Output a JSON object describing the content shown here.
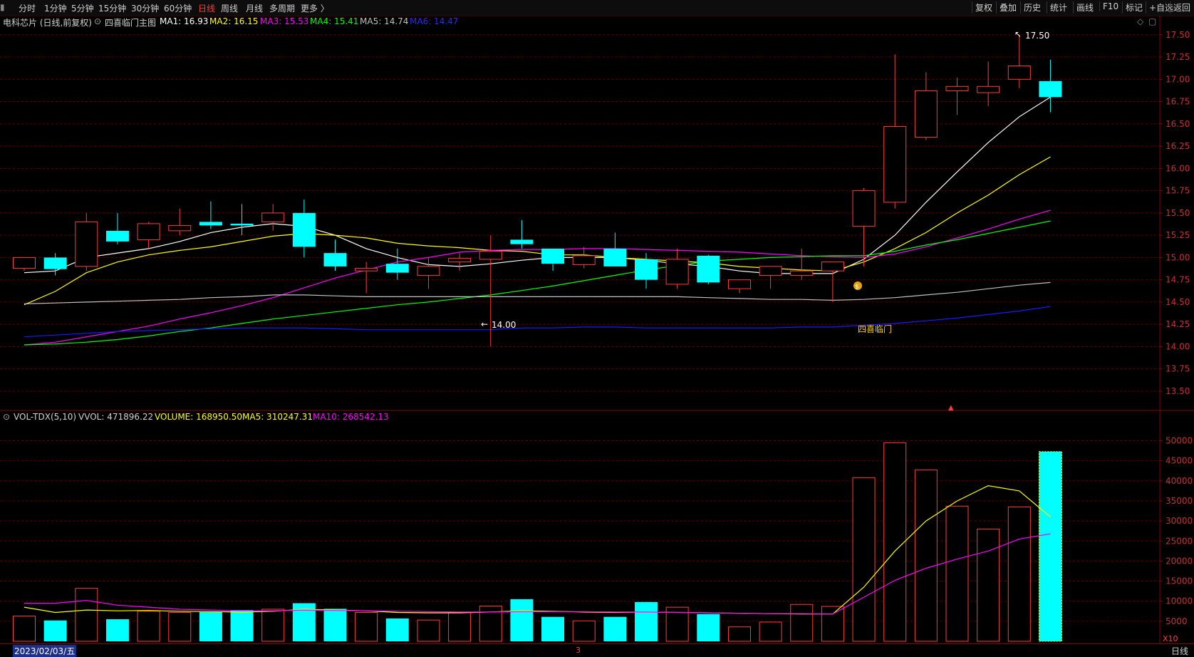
{
  "toolbar": {
    "left": [
      "分时",
      "1分钟",
      "5分钟",
      "15分钟",
      "30分钟",
      "60分钟",
      "日线",
      "周线",
      "月线",
      "多周期",
      "更多 〉"
    ],
    "active": "日线",
    "right": [
      "复权",
      "叠加",
      "历史",
      "统计",
      "画线",
      "F10",
      "标记",
      "+自选",
      "返回"
    ]
  },
  "main_info": {
    "stock": "电科芯片 (日线,前复权)",
    "indicator": "四喜临门主图",
    "ma1": "MA1: 16.93",
    "ma2": "MA2: 16.15",
    "ma3": "MA3: 15.53",
    "ma4": "MA4: 15.41",
    "ma5": "MA5: 14.74",
    "ma6": "MA6: 14.47"
  },
  "vol_info": {
    "title": "VOL-TDX(5,10)",
    "vvol": "VVOL: 471896.22",
    "volume": "VOLUME: 168950.50",
    "ma5": "MA5: 310247.31",
    "ma10": "MA10: 268542.13"
  },
  "annotations": {
    "high": "17.50",
    "low": "14.00",
    "signal": "四喜临门"
  },
  "bottom": {
    "date": "2023/02/03/五",
    "period": "日线",
    "marker": "3",
    "scale": "X10"
  },
  "colors": {
    "up": "#ff3b3b",
    "down": "#00ffff",
    "ma1": "#ffffff",
    "ma2": "#ffff00",
    "ma3": "#ff00ff",
    "ma4": "#00ff00",
    "ma5": "#c0c0c0",
    "ma6": "#1a1aff"
  },
  "chart_data": [
    {
      "type": "candlestick",
      "title": "电科芯片 (日线,前复权)",
      "ylim": [
        13.3,
        17.65
      ],
      "yticks": [
        "17.50",
        "17.25",
        "17.00",
        "16.75",
        "16.50",
        "16.25",
        "16.00",
        "15.75",
        "15.50",
        "15.25",
        "15.00",
        "14.75",
        "14.50",
        "14.25",
        "14.00",
        "13.75",
        "13.50"
      ],
      "candles": [
        {
          "o": 14.88,
          "h": 15.0,
          "l": 14.85,
          "c": 15.0
        },
        {
          "o": 15.0,
          "h": 15.05,
          "l": 14.8,
          "c": 14.87
        },
        {
          "o": 14.9,
          "h": 15.5,
          "l": 14.85,
          "c": 15.4
        },
        {
          "o": 15.3,
          "h": 15.5,
          "l": 15.15,
          "c": 15.18
        },
        {
          "o": 15.2,
          "h": 15.4,
          "l": 15.1,
          "c": 15.38
        },
        {
          "o": 15.3,
          "h": 15.55,
          "l": 15.25,
          "c": 15.36
        },
        {
          "o": 15.4,
          "h": 15.63,
          "l": 15.32,
          "c": 15.36
        },
        {
          "o": 15.38,
          "h": 15.6,
          "l": 15.25,
          "c": 15.36
        },
        {
          "o": 15.4,
          "h": 15.6,
          "l": 15.3,
          "c": 15.5
        },
        {
          "o": 15.5,
          "h": 15.65,
          "l": 15.0,
          "c": 15.12
        },
        {
          "o": 15.05,
          "h": 15.2,
          "l": 14.85,
          "c": 14.9
        },
        {
          "o": 14.85,
          "h": 14.95,
          "l": 14.6,
          "c": 14.88
        },
        {
          "o": 14.93,
          "h": 15.1,
          "l": 14.75,
          "c": 14.83
        },
        {
          "o": 14.8,
          "h": 15.0,
          "l": 14.65,
          "c": 14.9
        },
        {
          "o": 14.95,
          "h": 15.05,
          "l": 14.85,
          "c": 14.99
        },
        {
          "o": 14.98,
          "h": 15.25,
          "l": 14.0,
          "c": 15.07
        },
        {
          "o": 15.2,
          "h": 15.42,
          "l": 15.1,
          "c": 15.15
        },
        {
          "o": 15.1,
          "h": 15.1,
          "l": 14.85,
          "c": 14.93
        },
        {
          "o": 14.92,
          "h": 15.12,
          "l": 14.88,
          "c": 15.02
        },
        {
          "o": 15.1,
          "h": 15.28,
          "l": 14.9,
          "c": 14.9
        },
        {
          "o": 14.98,
          "h": 15.05,
          "l": 14.65,
          "c": 14.75
        },
        {
          "o": 14.7,
          "h": 15.1,
          "l": 14.65,
          "c": 14.98
        },
        {
          "o": 15.02,
          "h": 15.03,
          "l": 14.7,
          "c": 14.72
        },
        {
          "o": 14.65,
          "h": 14.75,
          "l": 14.6,
          "c": 14.75
        },
        {
          "o": 14.8,
          "h": 14.9,
          "l": 14.65,
          "c": 14.9
        },
        {
          "o": 14.8,
          "h": 15.1,
          "l": 14.75,
          "c": 14.85
        },
        {
          "o": 14.85,
          "h": 14.95,
          "l": 14.5,
          "c": 14.95
        },
        {
          "o": 15.35,
          "h": 15.78,
          "l": 14.9,
          "c": 15.75
        },
        {
          "o": 15.62,
          "h": 17.28,
          "l": 15.55,
          "c": 16.47
        },
        {
          "o": 16.35,
          "h": 17.08,
          "l": 16.32,
          "c": 16.87
        },
        {
          "o": 16.87,
          "h": 17.02,
          "l": 16.6,
          "c": 16.92
        },
        {
          "o": 16.85,
          "h": 17.2,
          "l": 16.7,
          "c": 16.92
        },
        {
          "o": 17.0,
          "h": 17.5,
          "l": 16.9,
          "c": 17.15
        },
        {
          "o": 16.98,
          "h": 17.22,
          "l": 16.63,
          "c": 16.8
        }
      ],
      "series": [
        {
          "name": "MA1",
          "values": [
            14.83,
            14.85,
            15.0,
            15.05,
            15.1,
            15.18,
            15.28,
            15.34,
            15.38,
            15.35,
            15.25,
            15.1,
            15.0,
            14.92,
            14.9,
            14.93,
            14.97,
            15.0,
            15.0,
            15.0,
            14.97,
            14.93,
            14.9,
            14.85,
            14.82,
            14.82,
            14.82,
            14.98,
            15.25,
            15.62,
            15.96,
            16.29,
            16.58,
            16.8
          ]
        },
        {
          "name": "MA2",
          "values": [
            14.47,
            14.62,
            14.83,
            14.95,
            15.03,
            15.08,
            15.12,
            15.18,
            15.24,
            15.27,
            15.25,
            15.22,
            15.16,
            15.13,
            15.11,
            15.08,
            15.07,
            15.03,
            15.03,
            15.0,
            14.98,
            14.96,
            14.94,
            14.9,
            14.88,
            14.86,
            14.85,
            14.95,
            15.1,
            15.28,
            15.5,
            15.7,
            15.93,
            16.13
          ]
        },
        {
          "name": "MA3",
          "values": [
            14.02,
            14.05,
            14.11,
            14.17,
            14.23,
            14.31,
            14.38,
            14.46,
            14.55,
            14.66,
            14.77,
            14.86,
            14.95,
            15.0,
            15.06,
            15.08,
            15.09,
            15.09,
            15.1,
            15.1,
            15.09,
            15.08,
            15.07,
            15.06,
            15.04,
            15.02,
            15.01,
            15.0,
            15.04,
            15.12,
            15.22,
            15.32,
            15.43,
            15.53
          ]
        },
        {
          "name": "MA4",
          "values": [
            14.02,
            14.03,
            14.05,
            14.08,
            14.12,
            14.17,
            14.21,
            14.26,
            14.31,
            14.35,
            14.39,
            14.43,
            14.47,
            14.5,
            14.54,
            14.58,
            14.63,
            14.68,
            14.74,
            14.8,
            14.86,
            14.91,
            14.96,
            14.98,
            15.0,
            15.01,
            15.02,
            15.02,
            15.07,
            15.14,
            15.2,
            15.27,
            15.34,
            15.41
          ]
        },
        {
          "name": "MA5",
          "values": [
            14.48,
            14.49,
            14.5,
            14.51,
            14.52,
            14.53,
            14.55,
            14.56,
            14.58,
            14.58,
            14.57,
            14.56,
            14.56,
            14.56,
            14.56,
            14.56,
            14.56,
            14.56,
            14.56,
            14.56,
            14.56,
            14.56,
            14.55,
            14.54,
            14.53,
            14.53,
            14.52,
            14.53,
            14.55,
            14.58,
            14.61,
            14.65,
            14.69,
            14.72
          ]
        },
        {
          "name": "MA6",
          "values": [
            14.11,
            14.13,
            14.15,
            14.17,
            14.18,
            14.19,
            14.2,
            14.21,
            14.21,
            14.21,
            14.2,
            14.19,
            14.19,
            14.19,
            14.19,
            14.19,
            14.21,
            14.21,
            14.22,
            14.22,
            14.21,
            14.21,
            14.21,
            14.21,
            14.21,
            14.22,
            14.22,
            14.24,
            14.26,
            14.29,
            14.32,
            14.36,
            14.4,
            14.45
          ]
        }
      ]
    },
    {
      "type": "bar",
      "title": "VOL-TDX(5,10)",
      "ylim": [
        0,
        54000
      ],
      "yticks": [
        "50000",
        "45000",
        "40000",
        "35000",
        "30000",
        "25000",
        "20000",
        "15000",
        "10000",
        "5000"
      ],
      "values": [
        6300,
        5200,
        13200,
        5500,
        7500,
        7200,
        7300,
        7800,
        8000,
        9500,
        8100,
        7200,
        5700,
        5300,
        7200,
        8800,
        10500,
        6100,
        5100,
        6100,
        9800,
        8500,
        6800,
        3600,
        4800,
        9200,
        8700,
        40800,
        49500,
        42700,
        33700,
        28000,
        33500,
        47300
      ],
      "up": [
        true,
        false,
        true,
        false,
        true,
        true,
        false,
        false,
        true,
        false,
        false,
        true,
        false,
        true,
        true,
        true,
        false,
        false,
        true,
        false,
        false,
        true,
        false,
        true,
        true,
        true,
        true,
        true,
        true,
        true,
        true,
        true,
        true,
        false
      ],
      "series": [
        {
          "name": "MA5",
          "values": [
            8500,
            7200,
            7800,
            7600,
            7700,
            7500,
            7400,
            7300,
            7500,
            8000,
            7800,
            7600,
            7200,
            7100,
            7100,
            7300,
            7600,
            7500,
            7300,
            7200,
            7300,
            7200,
            7100,
            7000,
            6900,
            6800,
            6800,
            13500,
            22500,
            30000,
            35000,
            38800,
            37500,
            31000
          ]
        },
        {
          "name": "MA10",
          "values": [
            9500,
            9500,
            10200,
            9000,
            8500,
            8000,
            7800,
            7600,
            7600,
            7800,
            7700,
            7600,
            7500,
            7400,
            7300,
            7300,
            7400,
            7400,
            7400,
            7300,
            7300,
            7200,
            7100,
            7000,
            6900,
            6900,
            6800,
            11000,
            15200,
            18200,
            20500,
            22500,
            25500,
            26800
          ]
        }
      ]
    }
  ]
}
